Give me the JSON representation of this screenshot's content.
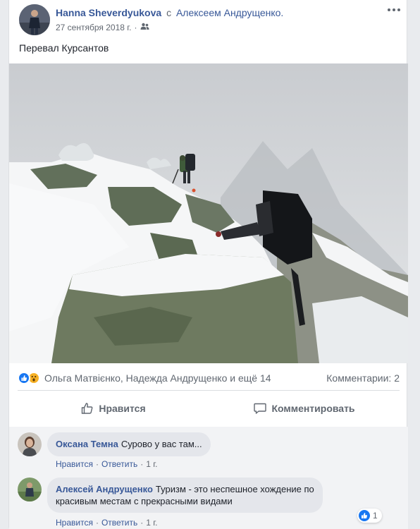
{
  "post": {
    "author": "Hanna Sheverdyukova",
    "with_text": "с",
    "tagged": "Алексеем Андрущенко.",
    "date": "27 сентября 2018 г.",
    "meta_dot": "·",
    "text": "Перевал Курсантов",
    "privacy_icon": "friends-icon",
    "more_icon": "more-horizontal-icon"
  },
  "reactions": {
    "icons": [
      "like-reaction-icon",
      "wow-reaction-icon"
    ],
    "summary": "Ольга Матвієнко, Надежда Андрущенко и ещё 14",
    "comments_count": "Комментарии: 2"
  },
  "actions": {
    "like_label": "Нравится",
    "comment_label": "Комментировать"
  },
  "comments": [
    {
      "author": "Оксана Темна",
      "text": "Сурово у вас там...",
      "like": "Нравится",
      "reply": "Ответить",
      "time": "1 г.",
      "sep": "·"
    },
    {
      "author": "Алексей Андрущенко",
      "text_line1": "Туризм - это неспешное хождение по",
      "text_line2": "красивым местам с прекрасными видами",
      "like": "Нравится",
      "reply": "Ответить",
      "time": "1 г.",
      "sep": "·",
      "like_count": "1"
    }
  ],
  "colors": {
    "link": "#385898",
    "muted": "#606770",
    "like_blue": "#1877f2",
    "wow_yellow": "#f7b125",
    "bubble": "#e4e6eb",
    "page_bg": "#e9ebee"
  }
}
